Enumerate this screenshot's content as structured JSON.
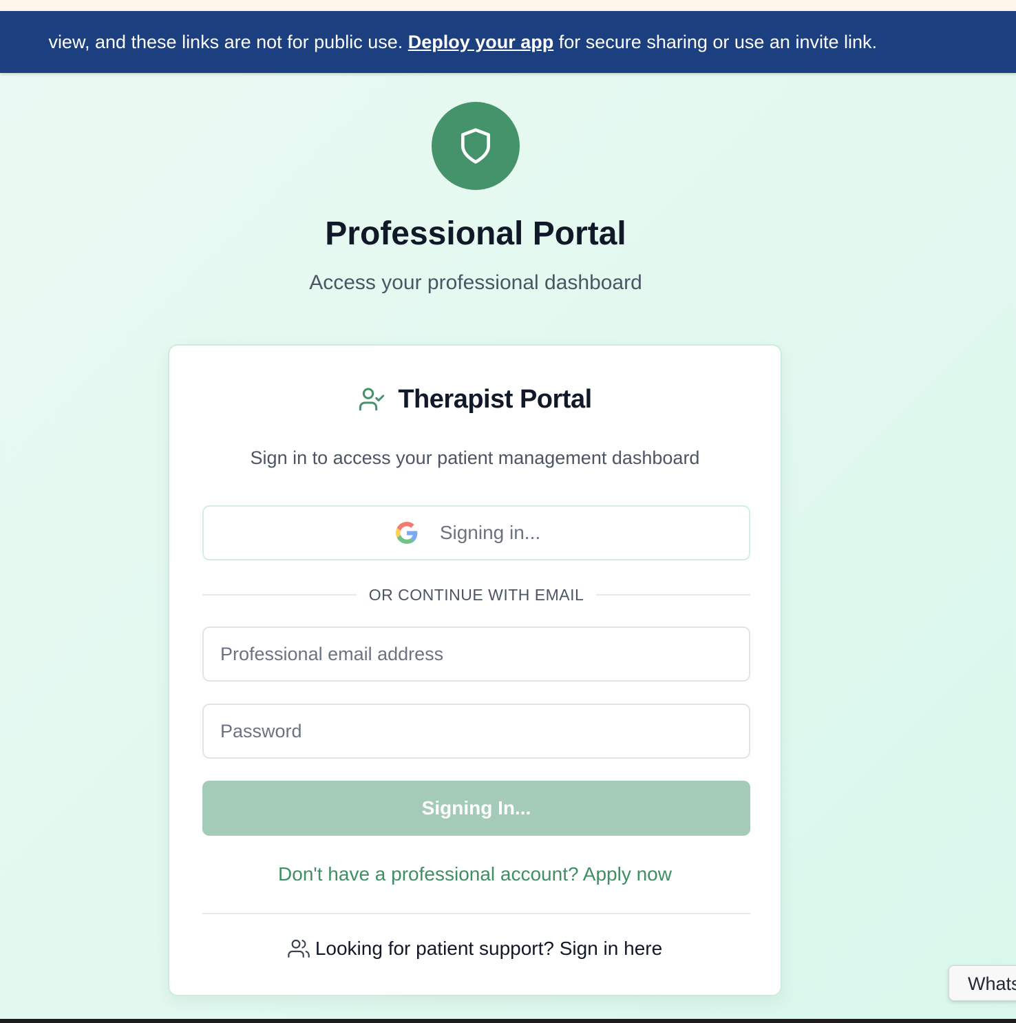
{
  "banner": {
    "text_before": "view, and these links are not for public use. ",
    "link_label": "Deploy your app",
    "text_after": " for secure sharing or use an invite link."
  },
  "header": {
    "logo_icon": "shield-icon",
    "title": "Professional Portal",
    "subtitle": "Access your professional dashboard"
  },
  "card": {
    "icon": "user-check-icon",
    "title": "Therapist Portal",
    "description": "Sign in to access your patient management dashboard",
    "google_button": {
      "icon": "google-icon",
      "label": "Signing in..."
    },
    "divider_text": "OR CONTINUE WITH EMAIL",
    "email_field": {
      "placeholder": "Professional email address",
      "value": ""
    },
    "password_field": {
      "placeholder": "Password",
      "value": ""
    },
    "submit_button": {
      "label": "Signing In...",
      "state": "disabled"
    },
    "apply_link": "Don't have a professional account? Apply now",
    "patient_link": {
      "icon": "users-icon",
      "label": "Looking for patient support? Sign in here"
    }
  },
  "floating_tip": {
    "label": "Whats"
  },
  "colors": {
    "banner_bg": "#1b3f7f",
    "brand_green": "#45936a",
    "link_green": "#3f8f62",
    "submit_disabled_bg": "#a3cbb8",
    "page_bg": "#e3f9f0"
  }
}
